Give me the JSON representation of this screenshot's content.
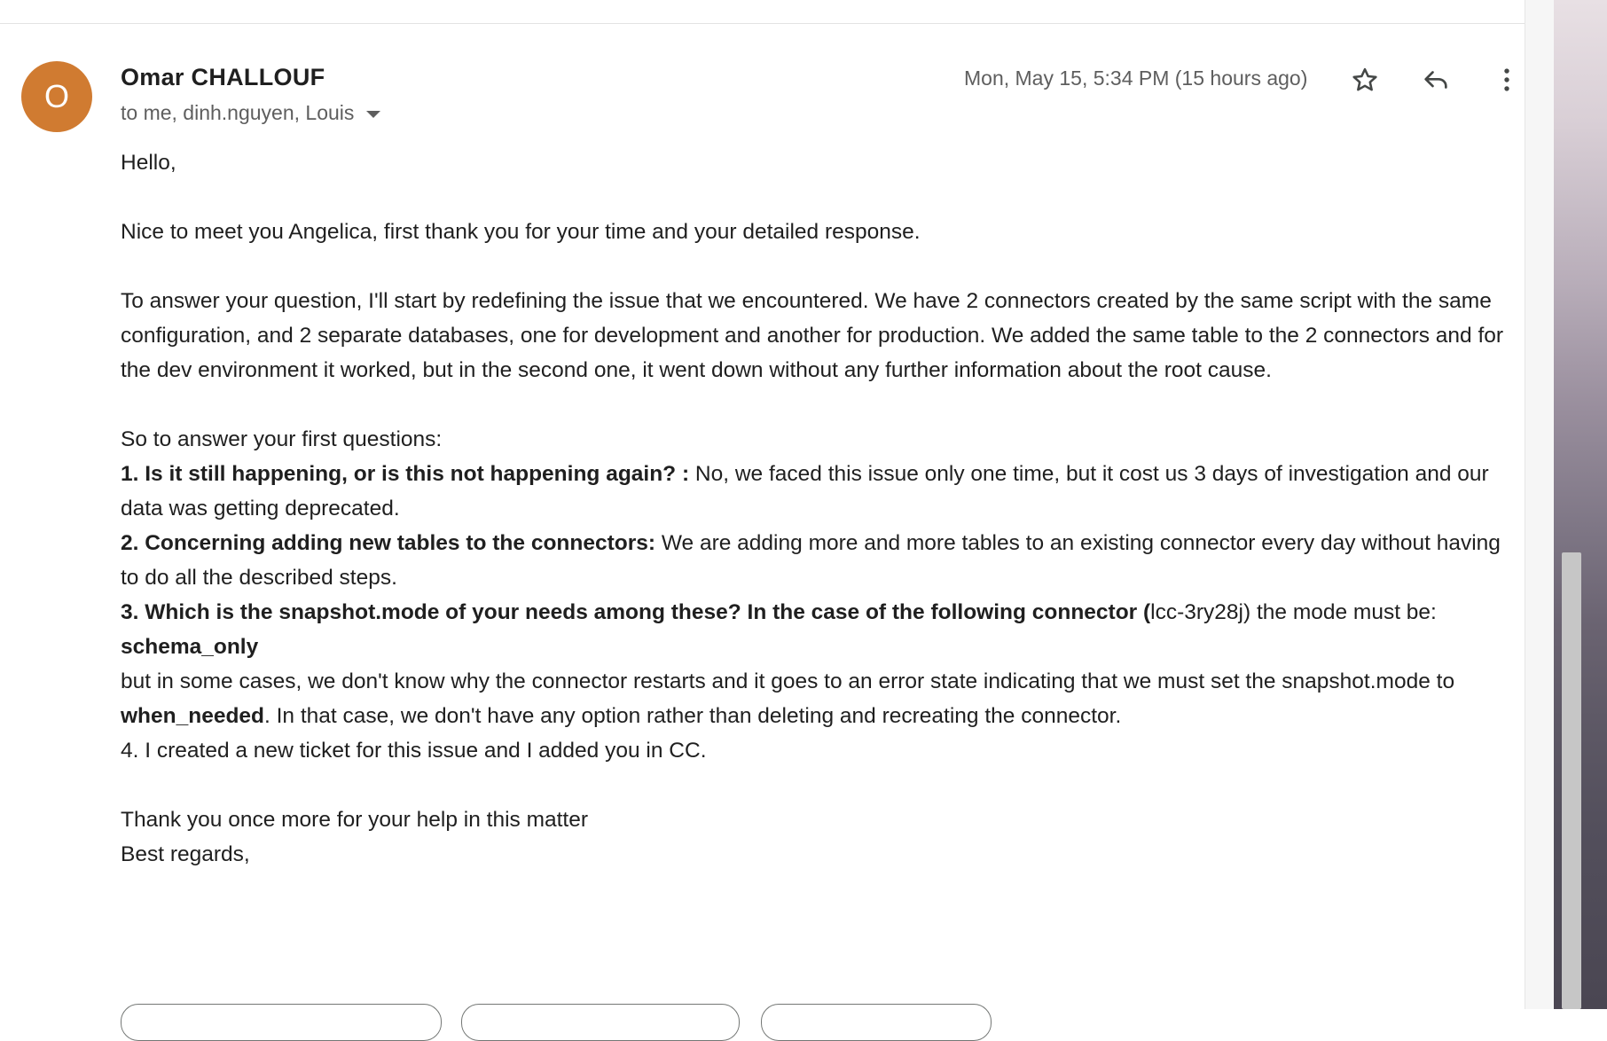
{
  "message": {
    "avatar_letter": "O",
    "avatar_color": "#d07b31",
    "sender_name": "Omar CHALLOUF",
    "recipients": "to me, dinh.nguyen, Louis",
    "date": "Mon, May 15, 5:34 PM (15 hours ago)"
  },
  "toolbar": {
    "star_icon": "star-icon",
    "reply_icon": "reply-icon",
    "more_icon": "more-vert-icon"
  },
  "body": {
    "greeting": "Hello,",
    "intro": "Nice to meet you Angelica, first thank you for your time and your detailed response.",
    "issue_paragraph": "To answer your question, I'll start by redefining the issue that we encountered. We have 2 connectors created by the same script with the same configuration, and 2 separate databases, one for development and another for production. We added the same table to the 2 connectors and for the dev environment it worked, but in the second one, it went down without any further information about the root cause.",
    "questions_intro": "So to answer your first questions:",
    "q1_bold": "1. Is it still happening, or is this not happening again?  :",
    "q1_text": " No, we faced this issue only one time, but it cost us 3 days of investigation and our data was getting deprecated.",
    "q2_bold": "2. Concerning adding new tables to the connectors:",
    "q2_text": " We are adding more and more tables to an existing connector every day without having to do all the described steps.",
    "q3_bold": "3. Which is the snapshot.mode of your needs among these? In the case of the following connector (",
    "q3_text": "lcc-3ry28j) the mode must be:",
    "q3_mode": "schema_only",
    "q3_followup_a": "but in some cases, we don't know why the connector restarts and it goes to an error state indicating that we must set the snapshot.mode to ",
    "q3_followup_bold": "when_needed",
    "q3_followup_b": ". In that case, we don't have any option rather than deleting and recreating the connector.",
    "q4_text": "4. I created a new ticket for this issue and I added you in CC.",
    "thanks": "Thank you once more for your help in this matter",
    "signoff": "Best regards,"
  }
}
